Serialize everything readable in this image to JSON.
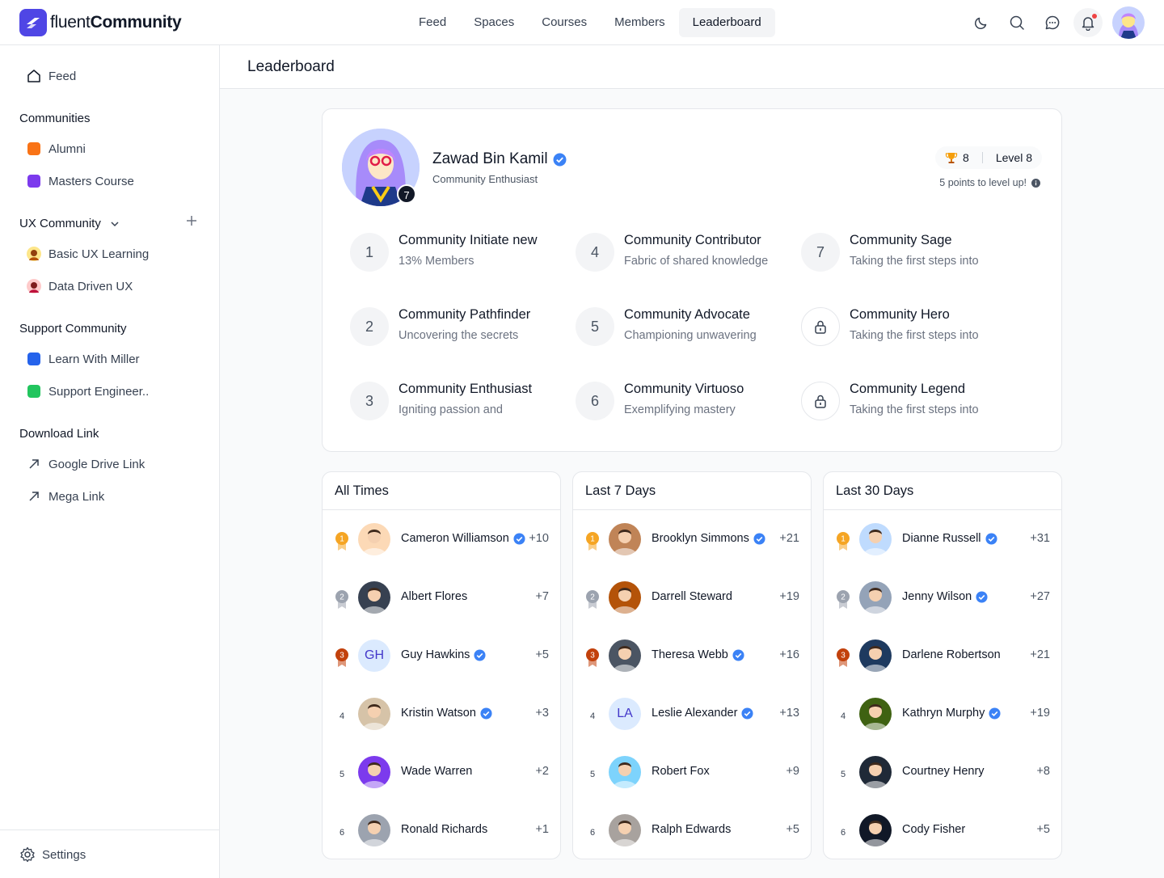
{
  "app": {
    "logo_light": "fluent",
    "logo_bold": "Community"
  },
  "topnav": [
    {
      "label": "Feed"
    },
    {
      "label": "Spaces"
    },
    {
      "label": "Courses"
    },
    {
      "label": "Members"
    },
    {
      "label": "Leaderboard",
      "active": true
    }
  ],
  "sidebar": {
    "feed": "Feed",
    "communities_title": "Communities",
    "communities": [
      {
        "label": "Alumni",
        "color": "#f97316"
      },
      {
        "label": "Masters Course",
        "color": "#7c3aed"
      }
    ],
    "ux_title": "UX Community",
    "ux_items": [
      {
        "label": "Basic UX Learning"
      },
      {
        "label": "Data Driven UX"
      }
    ],
    "support_title": "Support Community",
    "support_items": [
      {
        "label": "Learn With Miller",
        "color": "#2563eb"
      },
      {
        "label": "Support Engineer..",
        "color": "#22c55e"
      }
    ],
    "download_title": "Download Link",
    "download_items": [
      {
        "label": "Google Drive Link"
      },
      {
        "label": "Mega Link"
      }
    ],
    "settings": "Settings"
  },
  "page_title": "Leaderboard",
  "profile": {
    "name": "Zawad Bin Kamil",
    "subtitle": "Community Enthusiast",
    "level_badge": "7",
    "trophies": "8",
    "level": "Level 8",
    "to_level": "5 points to level up!"
  },
  "badges": [
    {
      "num": "1",
      "title": "Community Initiate new",
      "sub": "13% Members"
    },
    {
      "num": "4",
      "title": "Community Contributor",
      "sub": "Fabric of shared knowledge"
    },
    {
      "num": "7",
      "title": "Community Sage",
      "sub": "Taking the first steps into"
    },
    {
      "num": "2",
      "title": "Community Pathfinder",
      "sub": "Uncovering the secrets"
    },
    {
      "num": "5",
      "title": "Community Advocate",
      "sub": "Championing unwavering"
    },
    {
      "num": "",
      "title": "Community Hero",
      "sub": "Taking the first steps into",
      "locked": true
    },
    {
      "num": "3",
      "title": "Community Enthusiast",
      "sub": "Igniting passion and"
    },
    {
      "num": "6",
      "title": "Community Virtuoso",
      "sub": "Exemplifying mastery"
    },
    {
      "num": "",
      "title": "Community Legend",
      "sub": "Taking the first steps into",
      "locked": true
    }
  ],
  "leaderboards": [
    {
      "title": "All Times",
      "rows": [
        {
          "rank": "1",
          "name": "Cameron Williamson",
          "verified": true,
          "points": "+10",
          "avatar": "#fcd9b6",
          "initials": ""
        },
        {
          "rank": "2",
          "name": "Albert Flores",
          "verified": false,
          "points": "+7",
          "avatar": "#374151",
          "initials": ""
        },
        {
          "rank": "3",
          "name": "Guy Hawkins",
          "verified": true,
          "points": "+5",
          "avatar": "#dbeafe",
          "initials": "GH"
        },
        {
          "rank": "4",
          "name": "Kristin Watson",
          "verified": true,
          "points": "+3",
          "avatar": "#d6c3a8",
          "initials": ""
        },
        {
          "rank": "5",
          "name": "Wade Warren",
          "verified": false,
          "points": "+2",
          "avatar": "#7c3aed",
          "initials": ""
        },
        {
          "rank": "6",
          "name": "Ronald Richards",
          "verified": false,
          "points": "+1",
          "avatar": "#9ca3af",
          "initials": ""
        }
      ]
    },
    {
      "title": "Last 7 Days",
      "rows": [
        {
          "rank": "1",
          "name": "Brooklyn Simmons",
          "verified": true,
          "points": "+21",
          "avatar": "#c08457",
          "initials": ""
        },
        {
          "rank": "2",
          "name": "Darrell Steward",
          "verified": false,
          "points": "+19",
          "avatar": "#b45309",
          "initials": ""
        },
        {
          "rank": "3",
          "name": "Theresa Webb",
          "verified": true,
          "points": "+16",
          "avatar": "#4b5563",
          "initials": ""
        },
        {
          "rank": "4",
          "name": "Leslie Alexander",
          "verified": true,
          "points": "+13",
          "avatar": "#dbeafe",
          "initials": "LA"
        },
        {
          "rank": "5",
          "name": "Robert Fox",
          "verified": false,
          "points": "+9",
          "avatar": "#7dd3fc",
          "initials": ""
        },
        {
          "rank": "6",
          "name": "Ralph Edwards",
          "verified": false,
          "points": "+5",
          "avatar": "#a8a29e",
          "initials": ""
        }
      ]
    },
    {
      "title": "Last 30 Days",
      "rows": [
        {
          "rank": "1",
          "name": "Dianne Russell",
          "verified": true,
          "points": "+31",
          "avatar": "#bfdbfe",
          "initials": ""
        },
        {
          "rank": "2",
          "name": "Jenny Wilson",
          "verified": true,
          "points": "+27",
          "avatar": "#94a3b8",
          "initials": ""
        },
        {
          "rank": "3",
          "name": "Darlene Robertson",
          "verified": false,
          "points": "+21",
          "avatar": "#1e3a5f",
          "initials": ""
        },
        {
          "rank": "4",
          "name": "Kathryn Murphy",
          "verified": true,
          "points": "+19",
          "avatar": "#3f6212",
          "initials": ""
        },
        {
          "rank": "5",
          "name": "Courtney Henry",
          "verified": false,
          "points": "+8",
          "avatar": "#1f2937",
          "initials": ""
        },
        {
          "rank": "6",
          "name": "Cody Fisher",
          "verified": false,
          "points": "+5",
          "avatar": "#111827",
          "initials": ""
        }
      ]
    }
  ],
  "colors": {
    "accent": "#4f46e5",
    "verified": "#3b82f6",
    "gold": "#f5a524",
    "silver": "#9ca3af",
    "bronze": "#c2410c"
  },
  "icons": {
    "theme": "moon-icon",
    "search": "search-icon",
    "chat": "chat-icon",
    "notifications": "bell-icon"
  }
}
